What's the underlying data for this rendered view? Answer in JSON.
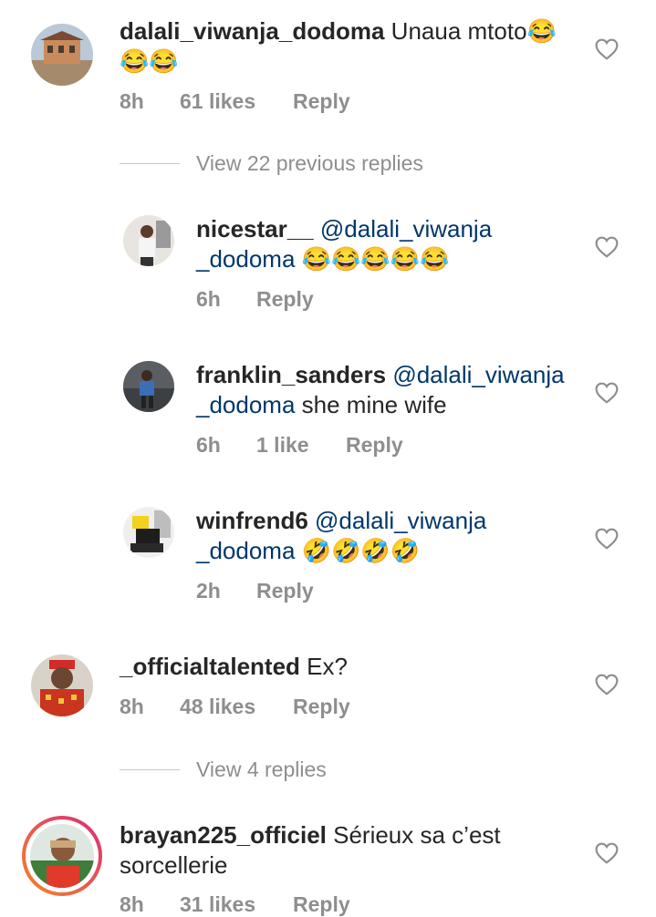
{
  "comments": [
    {
      "username": "dalali_viwanja_dodoma",
      "text": "Unaua mtoto😂",
      "text2": "😂😂",
      "time": "8h",
      "likes": "61 likes",
      "reply": "Reply"
    },
    {
      "view_replies": "View 22 previous replies"
    },
    {
      "username": "nicestar__",
      "mention": "@dalali_viwanja",
      "mention2": "_dodoma",
      "text": " 😂😂😂😂😂",
      "time": "6h",
      "reply": "Reply"
    },
    {
      "username": "franklin_sanders",
      "mention": "@dalali_viwanja",
      "mention2": "_dodoma",
      "text": " she mine wife",
      "time": "6h",
      "likes": "1 like",
      "reply": "Reply"
    },
    {
      "username": "winfrend6",
      "mention": "@dalali_viwanja",
      "mention2": "_dodoma",
      "text": " 🤣🤣🤣🤣",
      "time": "2h",
      "reply": "Reply"
    },
    {
      "username": "_officialtalented",
      "text": " Ex?",
      "time": "8h",
      "likes": "48 likes",
      "reply": "Reply"
    },
    {
      "view_replies": "View 4 replies"
    },
    {
      "username": "brayan225_officiel",
      "text": " Sérieux sa c’est",
      "text2": "sorcellerie",
      "time": "8h",
      "likes": "31 likes",
      "reply": "Reply"
    }
  ],
  "colors": {
    "text": "#262626",
    "meta": "#8e8e8e",
    "mention": "#00376b",
    "story_ring_start": "#f58529",
    "story_ring_end": "#dd2a7b"
  },
  "icons": {
    "like": "heart-outline-icon"
  }
}
